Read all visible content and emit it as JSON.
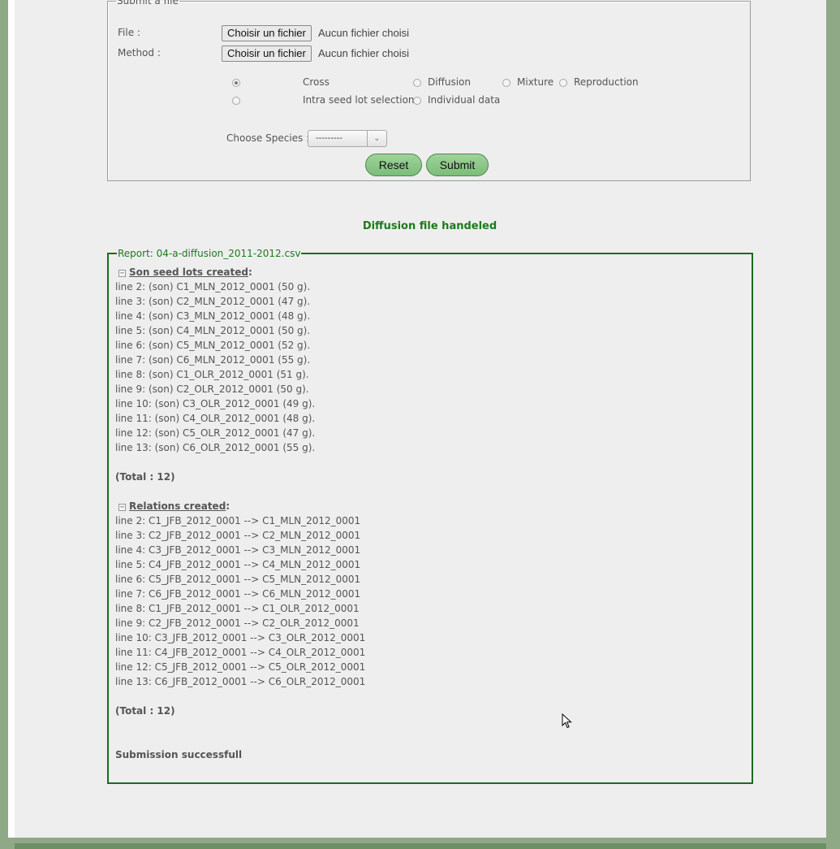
{
  "submit_form": {
    "legend": "Submit a file",
    "file_label": "File :",
    "method_label": "Method :",
    "file_button": "Choisir un fichier",
    "file_status": "Aucun fichier choisi",
    "method_button": "Choisir un fichier",
    "method_status": "Aucun fichier choisi",
    "radio_options": [
      {
        "label": "Cross",
        "checked": true
      },
      {
        "label": "Diffusion",
        "checked": false
      },
      {
        "label": "Mixture",
        "checked": false
      },
      {
        "label": "Reproduction",
        "checked": false
      },
      {
        "label": "Intra seed lot selection",
        "checked": false
      },
      {
        "label": "Individual data",
        "checked": false
      }
    ],
    "species_label": "Choose Species :",
    "species_value": "---------",
    "reset_label": "Reset",
    "submit_label": "Submit"
  },
  "status_message": "Diffusion file handeled",
  "report": {
    "legend": "Report: 04-a-diffusion_2011-2012.csv",
    "son_section_title": "Son seed lots created",
    "son_lines": [
      "line 2: (son) C1_MLN_2012_0001 (50 g).",
      "line 3: (son) C2_MLN_2012_0001 (47 g).",
      "line 4: (son) C3_MLN_2012_0001 (48 g).",
      "line 5: (son) C4_MLN_2012_0001 (50 g).",
      "line 6: (son) C5_MLN_2012_0001 (52 g).",
      "line 7: (son) C6_MLN_2012_0001 (55 g).",
      "line 8: (son) C1_OLR_2012_0001 (51 g).",
      "line 9: (son) C2_OLR_2012_0001 (50 g).",
      "line 10: (son) C3_OLR_2012_0001 (49 g).",
      "line 11: (son) C4_OLR_2012_0001 (48 g).",
      "line 12: (son) C5_OLR_2012_0001 (47 g).",
      "line 13: (son) C6_OLR_2012_0001 (55 g)."
    ],
    "son_total": "(Total : 12)",
    "relations_section_title": "Relations created",
    "relation_lines": [
      "line 2: C1_JFB_2012_0001 --> C1_MLN_2012_0001",
      "line 3: C2_JFB_2012_0001 --> C2_MLN_2012_0001",
      "line 4: C3_JFB_2012_0001 --> C3_MLN_2012_0001",
      "line 5: C4_JFB_2012_0001 --> C4_MLN_2012_0001",
      "line 6: C5_JFB_2012_0001 --> C5_MLN_2012_0001",
      "line 7: C6_JFB_2012_0001 --> C6_MLN_2012_0001",
      "line 8: C1_JFB_2012_0001 --> C1_OLR_2012_0001",
      "line 9: C2_JFB_2012_0001 --> C2_OLR_2012_0001",
      "line 10: C3_JFB_2012_0001 --> C3_OLR_2012_0001",
      "line 11: C4_JFB_2012_0001 --> C4_OLR_2012_0001",
      "line 12: C5_JFB_2012_0001 --> C5_OLR_2012_0001",
      "line 13: C6_JFB_2012_0001 --> C6_OLR_2012_0001"
    ],
    "relations_total": "(Total : 12)",
    "final_message": "Submission successfull"
  },
  "icons": {
    "section_toggle": "collapse-toggle-icon",
    "cursor": "mouse-pointer-icon"
  },
  "colors": {
    "accent_green": "#1d7a1d",
    "button_green": "#8fca8b",
    "side_background": "#8fa987"
  }
}
